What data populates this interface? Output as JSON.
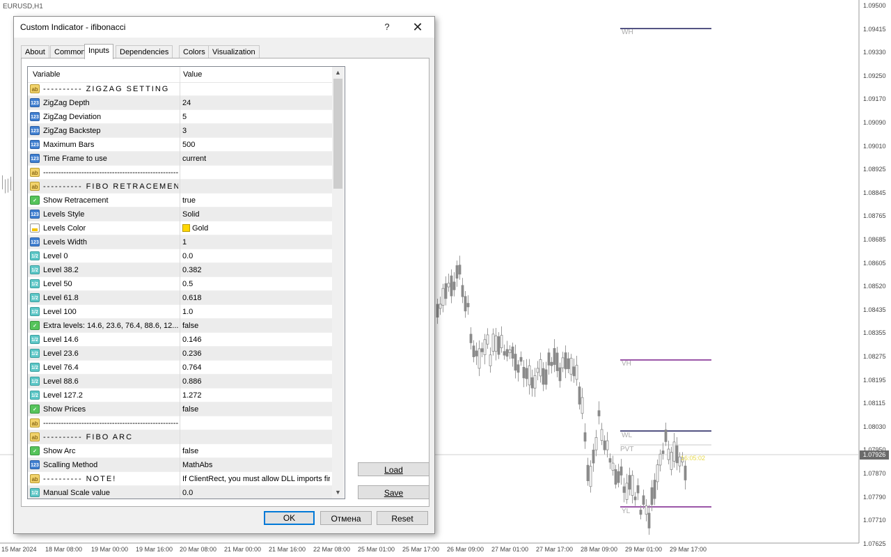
{
  "chart": {
    "symbol": "EURUSD,H1",
    "current_price": "1.07926",
    "timer": "16:05:02",
    "price_labels": [
      "1.09500",
      "1.09415",
      "1.09330",
      "1.09250",
      "1.09170",
      "1.09090",
      "1.09010",
      "1.08925",
      "1.08845",
      "1.08765",
      "1.08685",
      "1.08605",
      "1.08520",
      "1.08435",
      "1.08355",
      "1.08275",
      "1.08195",
      "1.08115",
      "1.08030",
      "1.07950",
      "1.07870",
      "1.07790",
      "1.07710",
      "1.07625"
    ],
    "time_labels": [
      "15 Mar 2024",
      "18 Mar 08:00",
      "19 Mar 00:00",
      "19 Mar 16:00",
      "20 Mar 08:00",
      "21 Mar 00:00",
      "21 Mar 16:00",
      "22 Mar 08:00",
      "25 Mar 01:00",
      "25 Mar 17:00",
      "26 Mar 09:00",
      "27 Mar 01:00",
      "27 Mar 17:00",
      "28 Mar 09:00",
      "29 Mar 01:00",
      "29 Mar 17:00"
    ],
    "levels": {
      "wh": "WH",
      "vh": "VH",
      "wl": "WL",
      "pvt": "PVT",
      "yl": "YL"
    },
    "level_colors": {
      "wh": "#1a1a5a",
      "vh": "#7a1e8c",
      "wl": "#1a1a5a",
      "pvt": "#c8c8c8",
      "yl": "#7a1e8c"
    }
  },
  "dialog": {
    "title": "Custom Indicator - ifibonacci",
    "help_label": "?",
    "close_label": "✕",
    "tabs": [
      "About",
      "Common",
      "Inputs",
      "Dependencies",
      "Colors",
      "Visualization"
    ],
    "active_tab": "Inputs",
    "grid": {
      "col_variable": "Variable",
      "col_value": "Value",
      "rows": [
        {
          "icon": "ab",
          "name": "---------- ZIGZAG SETTING",
          "value": ""
        },
        {
          "icon": "int",
          "name": "ZigZag Depth",
          "value": "24"
        },
        {
          "icon": "int",
          "name": "ZigZag Deviation",
          "value": "5"
        },
        {
          "icon": "int",
          "name": "ZigZag Backstep",
          "value": "3"
        },
        {
          "icon": "int",
          "name": "Maximum Bars",
          "value": "500"
        },
        {
          "icon": "int",
          "name": "Time Frame to use",
          "value": "current"
        },
        {
          "icon": "ab",
          "name": "--------------------------------------------------------",
          "value": ""
        },
        {
          "icon": "ab",
          "name": "---------- FIBO RETRACEMENT",
          "value": ""
        },
        {
          "icon": "bool",
          "name": "Show Retracement",
          "value": "true"
        },
        {
          "icon": "int",
          "name": "Levels Style",
          "value": "Solid"
        },
        {
          "icon": "color",
          "name": "Levels Color",
          "value": "Gold"
        },
        {
          "icon": "int",
          "name": "Levels Width",
          "value": "1"
        },
        {
          "icon": "dbl",
          "name": "Level 0",
          "value": "0.0"
        },
        {
          "icon": "dbl",
          "name": "Level 38.2",
          "value": "0.382"
        },
        {
          "icon": "dbl",
          "name": "Level 50",
          "value": "0.5"
        },
        {
          "icon": "dbl",
          "name": "Level 61.8",
          "value": "0.618"
        },
        {
          "icon": "dbl",
          "name": "Level 100",
          "value": "1.0"
        },
        {
          "icon": "bool",
          "name": "Extra levels: 14.6, 23.6, 76.4, 88.6, 12...",
          "value": "false"
        },
        {
          "icon": "dbl",
          "name": "Level 14.6",
          "value": "0.146"
        },
        {
          "icon": "dbl",
          "name": "Level 23.6",
          "value": "0.236"
        },
        {
          "icon": "dbl",
          "name": "Level 76.4",
          "value": "0.764"
        },
        {
          "icon": "dbl",
          "name": "Level 88.6",
          "value": "0.886"
        },
        {
          "icon": "dbl",
          "name": "Level 127.2",
          "value": "1.272"
        },
        {
          "icon": "bool",
          "name": "Show Prices",
          "value": "false"
        },
        {
          "icon": "ab",
          "name": "--------------------------------------------------------",
          "value": ""
        },
        {
          "icon": "ab",
          "name": "---------- FIBO ARC",
          "value": ""
        },
        {
          "icon": "bool",
          "name": "Show Arc",
          "value": "false"
        },
        {
          "icon": "int",
          "name": "Scalling Method",
          "value": "MathAbs"
        },
        {
          "icon": "ab",
          "name": "---------- NOTE!",
          "value": "If ClientRect, you must allow DLL imports first"
        },
        {
          "icon": "dbl",
          "name": "Manual Scale value",
          "value": "0.0"
        }
      ]
    },
    "load_label": "Load",
    "save_label": "Save",
    "ok_label": "OK",
    "cancel_label": "Отмена",
    "reset_label": "Reset"
  }
}
